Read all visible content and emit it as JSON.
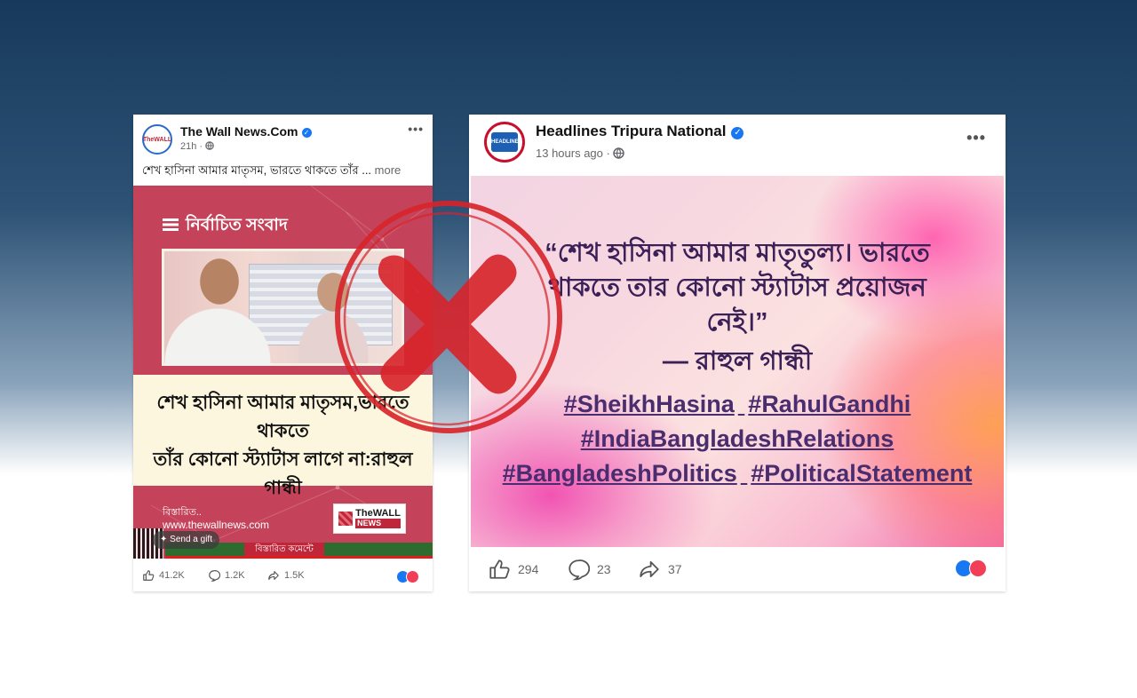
{
  "left_post": {
    "page_name": "The Wall News.Com",
    "time": "21h",
    "caption": "শেখ হাসিনা আমার মাতৃসম, ভারতে থাকতে তাঁর ...",
    "more_label": "more",
    "avatar_text": "TheWALL",
    "section_title": "নির্বাচিত সংবাদ",
    "headline_line1": "শেখ হাসিনা আমার মাতৃসম,ভারতে থাকতে",
    "headline_line2": "তাঁর কোনো স্ট্যাটাস লাগে না:রাহুল গান্ধী",
    "details_label": "বিস্তারিত..",
    "website": "www.thewallnews.com",
    "logo_text": "TheWALL",
    "logo_sub": "NEWS",
    "gift_label": "Send a gift",
    "cta_label": "বিস্তারিত কমেন্টে",
    "likes": "41.2K",
    "comments": "1.2K",
    "shares": "1.5K"
  },
  "right_post": {
    "page_name": "Headlines Tripura National",
    "time": "13 hours ago",
    "avatar_text": "HEADLINES",
    "quote_line1": "“শেখ হাসিনা আমার মাতৃতুল্য। ভারতে",
    "quote_line2": "থাকতে তার কোনো স্ট্যাটাস প্রয়োজন",
    "quote_line3": "নেই।”",
    "author": "— রাহুল গান্ধী",
    "hashtags_line1": [
      "#SheikhHasina",
      "#RahulGandhi"
    ],
    "hashtags_line2": [
      "#IndiaBangladeshRelations"
    ],
    "hashtags_line3": [
      "#BangladeshPolitics",
      "#PoliticalStatement"
    ],
    "likes": "294",
    "comments": "23",
    "shares": "37"
  },
  "icons": [
    "verified-icon",
    "globe-icon",
    "more-options-icon",
    "like-icon",
    "comment-icon",
    "share-icon",
    "menu-icon",
    "cross-stamp-icon"
  ],
  "colors": {
    "stamp_red": "#d8232a",
    "banner_red": "#c4435a",
    "facebook_blue": "#1877f2",
    "love_red": "#f33e58",
    "quote_purple": "#3b1f57"
  }
}
